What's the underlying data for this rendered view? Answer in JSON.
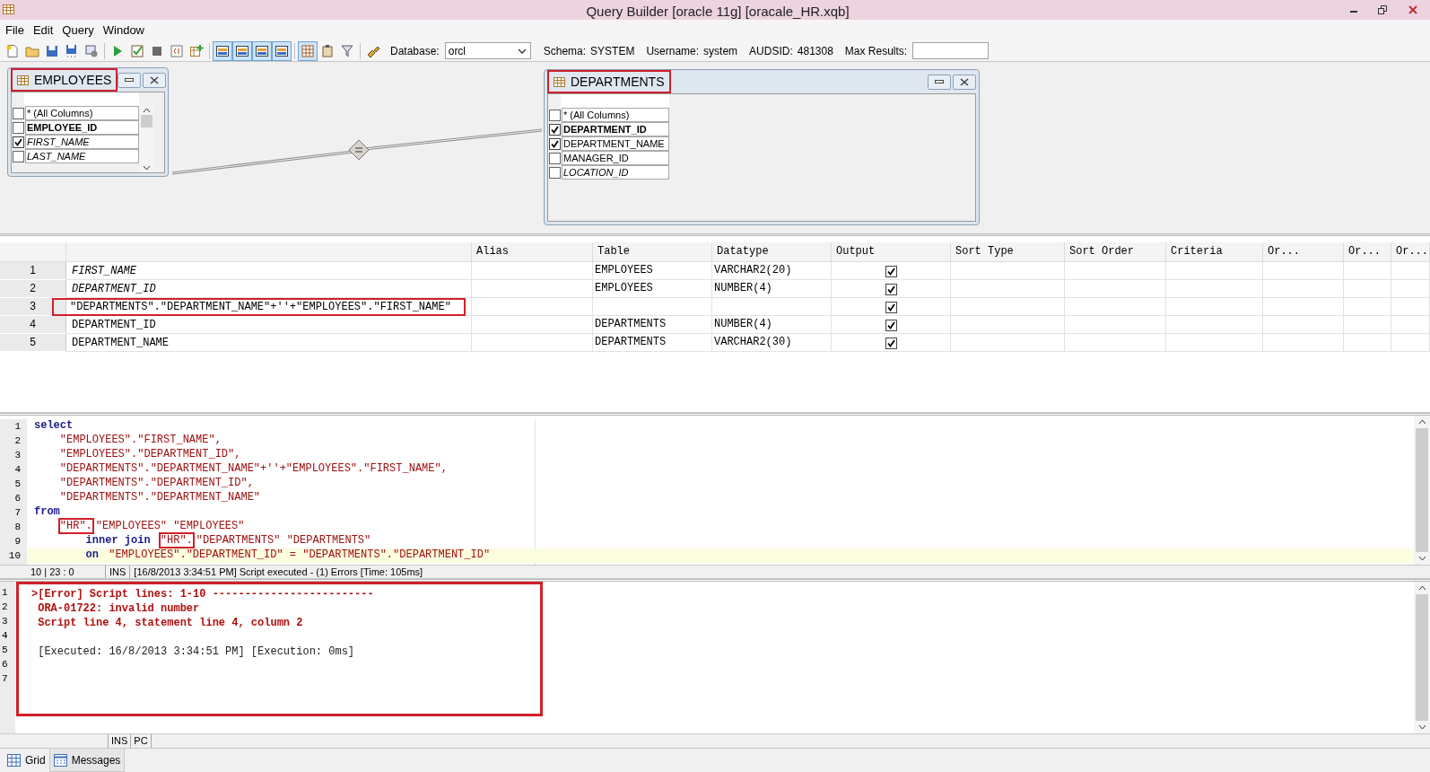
{
  "window": {
    "title": "Query Builder [oracle 11g] [oracale_HR.xqb]"
  },
  "menu": [
    "File",
    "Edit",
    "Query",
    "Window"
  ],
  "toolbar": {
    "buttons": [
      {
        "kind": "new",
        "pressed": false
      },
      {
        "kind": "open",
        "pressed": false
      },
      {
        "kind": "save",
        "pressed": false
      },
      {
        "kind": "save-all",
        "pressed": false
      },
      {
        "kind": "properties",
        "pressed": false
      },
      {
        "kind": "separator"
      },
      {
        "kind": "run",
        "pressed": false
      },
      {
        "kind": "run-step",
        "pressed": false
      },
      {
        "kind": "stop",
        "pressed": false
      },
      {
        "kind": "sql",
        "pressed": false
      },
      {
        "kind": "add-table",
        "pressed": false
      },
      {
        "kind": "separator"
      },
      {
        "kind": "layout",
        "pressed": true
      },
      {
        "kind": "layout",
        "pressed": true
      },
      {
        "kind": "layout",
        "pressed": true
      },
      {
        "kind": "layout",
        "pressed": true
      },
      {
        "kind": "separator"
      },
      {
        "kind": "grid",
        "pressed": true
      },
      {
        "kind": "clipboard",
        "pressed": false
      },
      {
        "kind": "filter",
        "pressed": false
      },
      {
        "kind": "separator"
      },
      {
        "kind": "connect",
        "pressed": false
      }
    ],
    "database_label": "Database:",
    "database": "orcl",
    "info": [
      {
        "label": "Schema:",
        "value": "SYSTEM"
      },
      {
        "label": "Username:",
        "value": "system"
      },
      {
        "label": "AUDSID:",
        "value": "481308"
      }
    ],
    "max_results_label": "Max Results:"
  },
  "diagram": {
    "tables": [
      {
        "title": "EMPLOYEES",
        "highlighted": true,
        "scrollbar": true,
        "columns": [
          {
            "name": "* (All Columns)",
            "checked": false,
            "kind": "wildcard"
          },
          {
            "name": "EMPLOYEE_ID",
            "checked": false,
            "kind": "key"
          },
          {
            "name": "FIRST_NAME",
            "checked": true,
            "kind": "emphasized"
          },
          {
            "name": "LAST_NAME",
            "checked": false,
            "kind": "emphasized"
          }
        ]
      },
      {
        "title": "DEPARTMENTS",
        "highlighted": true,
        "scrollbar": false,
        "columns": [
          {
            "name": "* (All Columns)",
            "checked": false,
            "kind": "wildcard"
          },
          {
            "name": "DEPARTMENT_ID",
            "checked": true,
            "kind": "key"
          },
          {
            "name": "DEPARTMENT_NAME",
            "checked": true,
            "kind": "regular"
          },
          {
            "name": "MANAGER_ID",
            "checked": false,
            "kind": "regular"
          },
          {
            "name": "LOCATION_ID",
            "checked": false,
            "kind": "emphasized"
          }
        ]
      }
    ]
  },
  "grid": {
    "columns": [
      "Alias",
      "Table",
      "Datatype",
      "Output",
      "Sort Type",
      "Sort Order",
      "Criteria",
      "Or...",
      "Or...",
      "Or..."
    ],
    "rows": [
      {
        "number": "1",
        "expression": "FIRST_NAME",
        "italic": true,
        "highlighted": false,
        "table": "EMPLOYEES",
        "datatype": "VARCHAR2(20)",
        "output": true
      },
      {
        "number": "2",
        "expression": "DEPARTMENT_ID",
        "italic": true,
        "highlighted": false,
        "table": "EMPLOYEES",
        "datatype": "NUMBER(4)",
        "output": true
      },
      {
        "number": "3",
        "expression": "\"DEPARTMENTS\".\"DEPARTMENT_NAME\"+''+\"EMPLOYEES\".\"FIRST_NAME\"",
        "italic": false,
        "highlighted": true,
        "output": true
      },
      {
        "number": "4",
        "expression": "DEPARTMENT_ID",
        "italic": false,
        "highlighted": false,
        "table": "DEPARTMENTS",
        "datatype": "NUMBER(4)",
        "output": true
      },
      {
        "number": "5",
        "expression": "DEPARTMENT_NAME",
        "italic": false,
        "highlighted": false,
        "table": "DEPARTMENTS",
        "datatype": "VARCHAR2(30)",
        "output": true
      }
    ]
  },
  "editor": {
    "lines": [
      {
        "number": "1",
        "current": false,
        "segments": [
          {
            "text": "select",
            "kind": "keyword",
            "highlighted": false
          }
        ]
      },
      {
        "number": "2",
        "current": false,
        "segments": [
          {
            "text": "    \"EMPLOYEES\".\"FIRST_NAME\",",
            "kind": "string",
            "highlighted": false
          }
        ]
      },
      {
        "number": "3",
        "current": false,
        "segments": [
          {
            "text": "    \"EMPLOYEES\".\"DEPARTMENT_ID\",",
            "kind": "string",
            "highlighted": false
          }
        ]
      },
      {
        "number": "4",
        "current": false,
        "segments": [
          {
            "text": "    \"DEPARTMENTS\".\"DEPARTMENT_NAME\"+''+\"EMPLOYEES\".\"FIRST_NAME\",",
            "kind": "string",
            "highlighted": false
          }
        ]
      },
      {
        "number": "5",
        "current": false,
        "segments": [
          {
            "text": "    \"DEPARTMENTS\".\"DEPARTMENT_ID\",",
            "kind": "string",
            "highlighted": false
          }
        ]
      },
      {
        "number": "6",
        "current": false,
        "segments": [
          {
            "text": "    \"DEPARTMENTS\".\"DEPARTMENT_NAME\"",
            "kind": "string",
            "highlighted": false
          }
        ]
      },
      {
        "number": "7",
        "current": false,
        "segments": [
          {
            "text": "from",
            "kind": "keyword",
            "highlighted": false
          }
        ]
      },
      {
        "number": "8",
        "current": false,
        "segments": [
          {
            "text": "    \"HR\".",
            "kind": "string",
            "highlighted": true
          },
          {
            "text": "\"EMPLOYEES\" \"EMPLOYEES\"",
            "kind": "string",
            "highlighted": false
          }
        ]
      },
      {
        "number": "9",
        "current": false,
        "segments": [
          {
            "text": "        inner join",
            "kind": "keyword",
            "highlighted": false
          },
          {
            "text": " \"HR\".",
            "kind": "string",
            "highlighted": true
          },
          {
            "text": "\"DEPARTMENTS\" \"DEPARTMENTS\"",
            "kind": "string",
            "highlighted": false
          }
        ]
      },
      {
        "number": "10",
        "current": true,
        "segments": [
          {
            "text": "        on",
            "kind": "keyword",
            "highlighted": false
          },
          {
            "text": " \"EMPLOYEES\".\"DEPARTMENT_ID\" = \"DEPARTMENTS\".\"DEPARTMENT_ID\"",
            "kind": "string",
            "highlighted": false
          }
        ]
      }
    ],
    "status": {
      "position": "10 | 23 : 0",
      "mode": "INS",
      "message": "[16/8/2013 3:34:51 PM] Script executed - (1) Errors [Time: 105ms]"
    }
  },
  "messages": {
    "highlighted": true,
    "lines": [
      {
        "number": "1",
        "text": ">[Error] Script lines: 1-10 -------------------------",
        "kind": "error"
      },
      {
        "number": "2",
        "text": " ORA-01722: invalid number",
        "kind": "error"
      },
      {
        "number": "3",
        "text": " Script line 4, statement line 4, column 2",
        "kind": "error"
      },
      {
        "number": "4"
      },
      {
        "number": "5",
        "text": " [Executed: 16/8/2013 3:34:51 PM] [Execution: 0ms]",
        "kind": "info"
      },
      {
        "number": "6"
      },
      {
        "number": "7"
      }
    ]
  },
  "status_bar": [
    "INS",
    "PC"
  ],
  "bottom_tabs": [
    {
      "label": "Grid",
      "selected": false
    },
    {
      "label": "Messages",
      "selected": true
    }
  ]
}
